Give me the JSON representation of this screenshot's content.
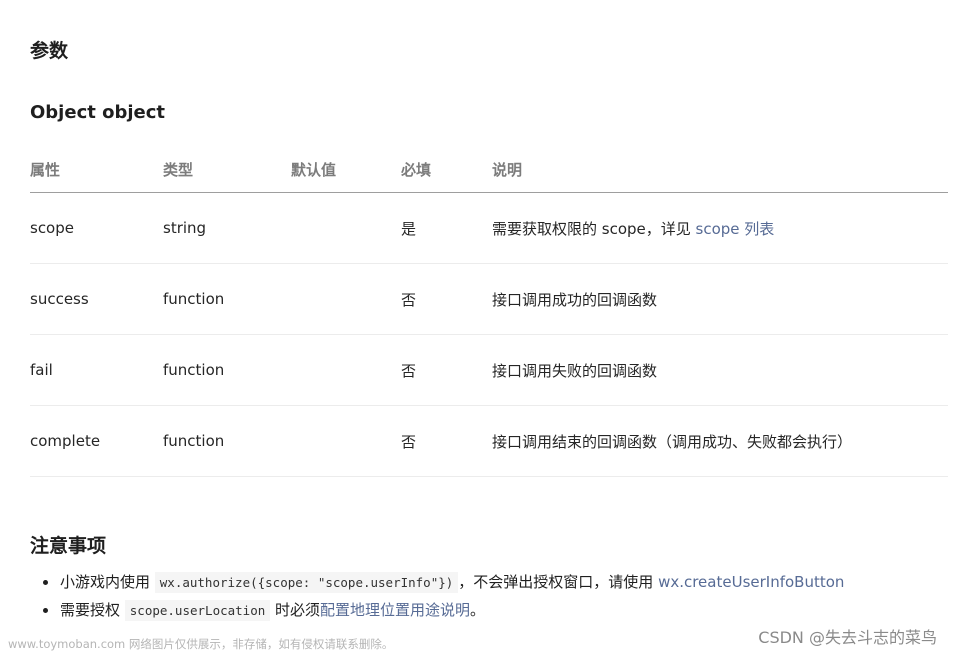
{
  "section_title": "参数",
  "object_title": "Object object",
  "table": {
    "headers": [
      "属性",
      "类型",
      "默认值",
      "必填",
      "说明"
    ],
    "rows": [
      {
        "attr": "scope",
        "type": "string",
        "default": "",
        "required": "是",
        "desc": "需要获取权限的 scope，详见 ",
        "desc_link": "scope 列表",
        "desc_after": ""
      },
      {
        "attr": "success",
        "type": "function",
        "default": "",
        "required": "否",
        "desc": "接口调用成功的回调函数",
        "desc_link": "",
        "desc_after": ""
      },
      {
        "attr": "fail",
        "type": "function",
        "default": "",
        "required": "否",
        "desc": "接口调用失败的回调函数",
        "desc_link": "",
        "desc_after": ""
      },
      {
        "attr": "complete",
        "type": "function",
        "default": "",
        "required": "否",
        "desc": "接口调用结束的回调函数（调用成功、失败都会执行）",
        "desc_link": "",
        "desc_after": ""
      }
    ]
  },
  "notes_title": "注意事项",
  "notes": [
    {
      "before": "小游戏内使用 ",
      "code": "wx.authorize({scope: \"scope.userInfo\"})",
      "middle": "，不会弹出授权窗口，请使用 ",
      "link": "wx.createUserInfoButton",
      "after": ""
    },
    {
      "before": "需要授权 ",
      "code": "scope.userLocation",
      "middle": " 时必须",
      "link": "配置地理位置用途说明",
      "after": "。"
    }
  ],
  "watermark_left": "www.toymoban.com 网络图片仅供展示，非存储，如有侵权请联系删除。",
  "watermark_right": "CSDN @失去斗志的菜鸟"
}
